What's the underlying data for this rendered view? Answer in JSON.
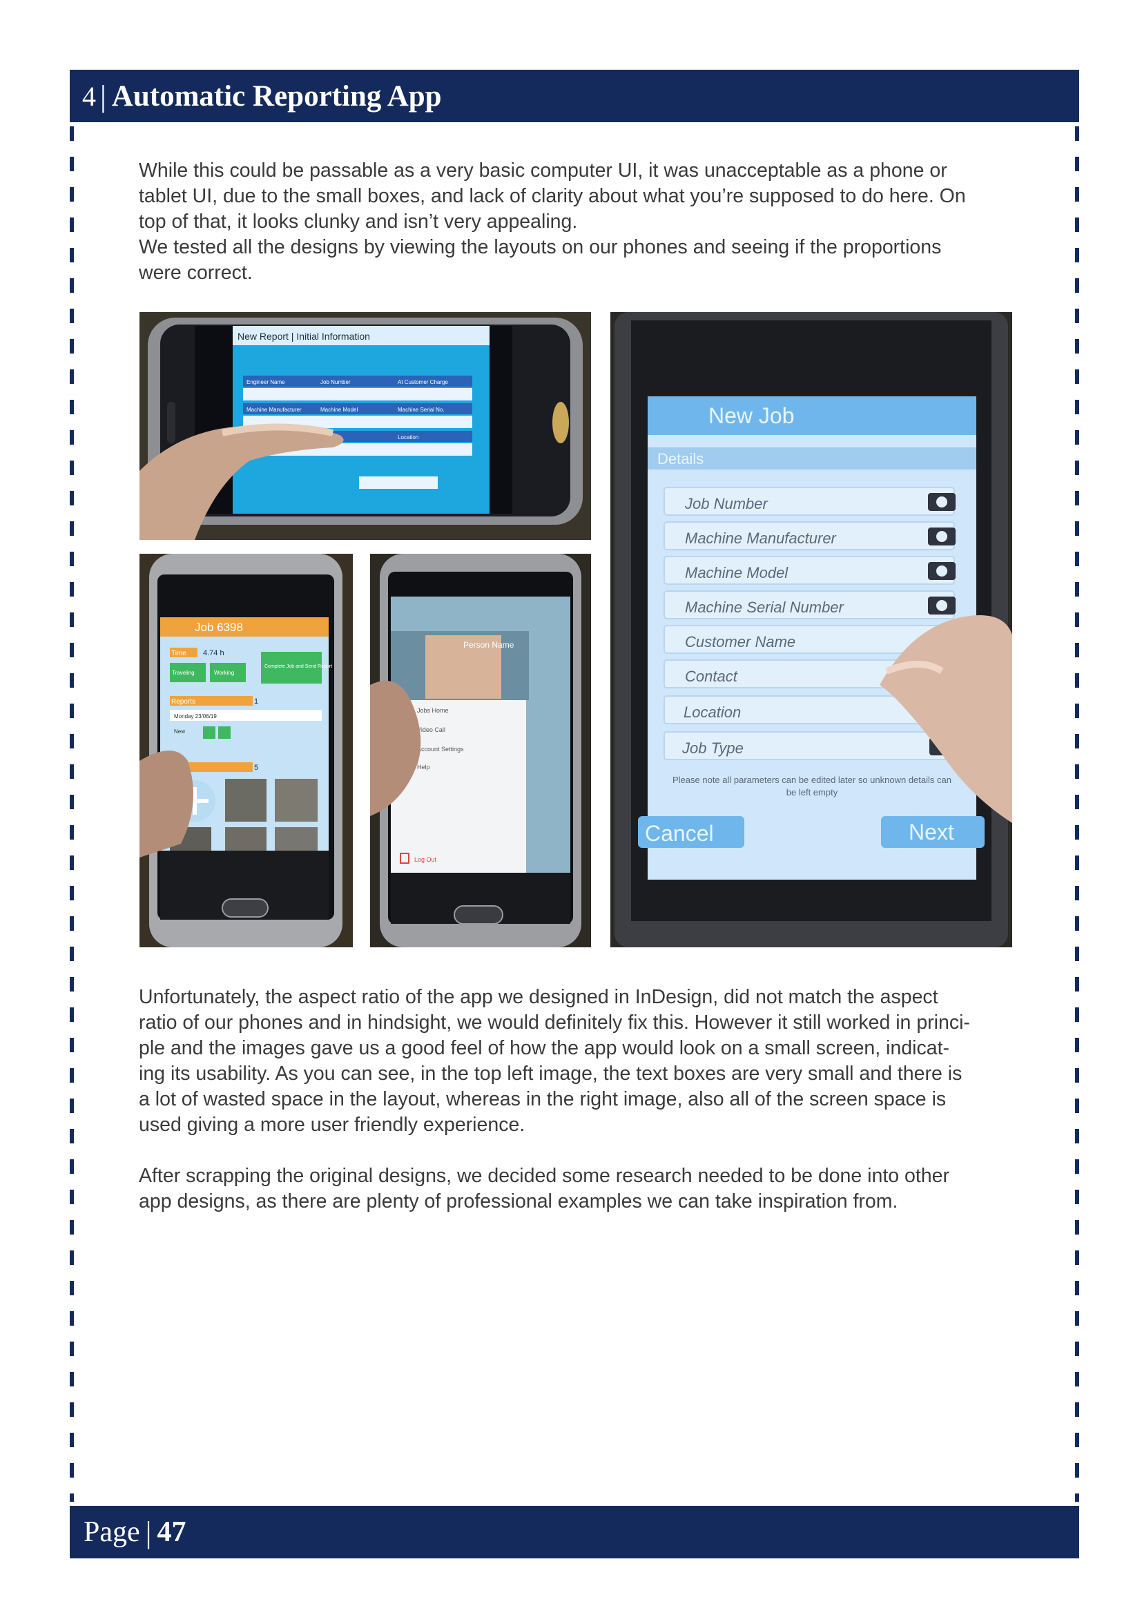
{
  "header": {
    "number": "4",
    "title": "Automatic Reporting App"
  },
  "intro": {
    "lines": [
      "While this could be passable as a very basic computer UI, it was unacceptable as a phone or",
      "tablet UI, due to the small boxes, and lack of clarity about what you’re supposed to do here. On",
      "top of that, it looks clunky and isn’t very appealing.",
      "We tested all the designs by viewing the layouts on our phones and seeing if the proportions",
      "were correct."
    ]
  },
  "photo_top_left": {
    "title": "New Report | Initial Information",
    "fields": [
      "Engineer Name",
      "Job Number",
      "At Customer Charge",
      "Machine Manufacturer",
      "Machine Model",
      "Machine Serial No.",
      "Location"
    ]
  },
  "photo_bottom_left": {
    "job_title": "Job 6398",
    "time_label": "Time",
    "time_value": "4.74 h",
    "btn_traveling": "Traveling",
    "btn_working": "Working",
    "btn_complete": "Complete Job and Send Report",
    "reports_label": "Reports",
    "reports_count": "1",
    "report_date": "Monday 23/06/19",
    "report_status": "New",
    "photos_count": "5"
  },
  "photo_bottom_middle": {
    "person_name": "Person Name",
    "menu": [
      "Jobs Home",
      "Video Call",
      "Account Settings",
      "Help"
    ],
    "logout": "Log Out"
  },
  "photo_right": {
    "title": "New Job",
    "section": "Details",
    "fields": [
      "Job Number",
      "Machine Manufacturer",
      "Machine Model",
      "Machine Serial Number",
      "Customer Name",
      "Contact",
      "Location",
      "Job Type"
    ],
    "note_line1": "Please note all parameters can be edited later so unknown details can",
    "note_line2": "be left empty",
    "cancel": "Cancel",
    "next": "Next"
  },
  "body2": {
    "lines": [
      "Unfortunately, the aspect ratio of the app we designed in InDesign, did not match the aspect",
      "ratio of our phones and in hindsight, we would definitely fix this. However it still worked in princi-",
      "ple and the images gave us a good feel of how the app would look on a small screen, indicat-",
      "ing its usability. As you can see, in the top left image, the text boxes are very small and there is",
      "a lot of wasted space in the layout, whereas in the right image, also all of the screen space is",
      "used giving a more user friendly experience."
    ]
  },
  "body3": {
    "lines": [
      "After scrapping the original designs, we decided some research needed to be done into other",
      "app designs, as there are plenty of professional examples we can take inspiration from."
    ]
  },
  "footer": {
    "label": "Page",
    "number": "47"
  }
}
